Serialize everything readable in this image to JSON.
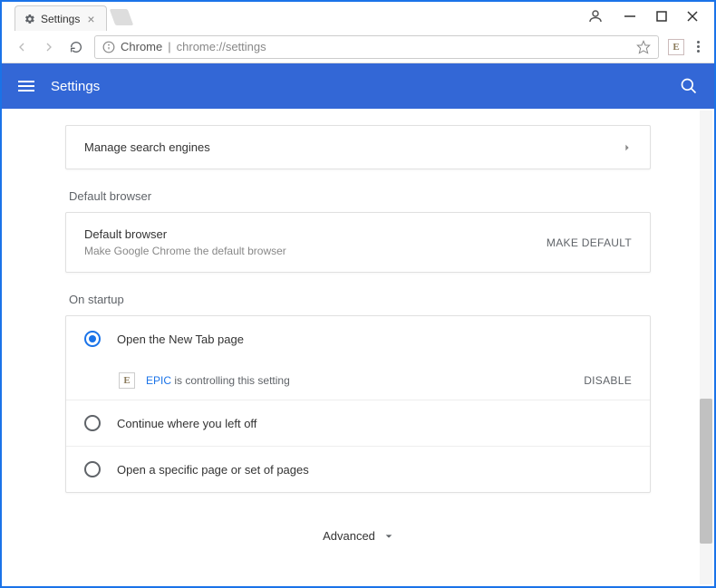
{
  "window": {
    "tab_title": "Settings",
    "account_icon": "account-icon",
    "minimize": "—",
    "maximize": "☐",
    "close": "✕"
  },
  "toolbar": {
    "chrome_label": "Chrome",
    "url": "chrome://settings",
    "ext_badge": "E"
  },
  "header": {
    "title": "Settings"
  },
  "manage_search": {
    "label": "Manage search engines"
  },
  "default_browser": {
    "section": "Default browser",
    "title": "Default browser",
    "subtitle": "Make Google Chrome the default browser",
    "action": "MAKE DEFAULT"
  },
  "startup": {
    "section": "On startup",
    "option1": "Open the New Tab page",
    "ext_badge": "E",
    "ext_name": "EPIC",
    "ext_msg": " is controlling this setting",
    "disable": "DISABLE",
    "option2": "Continue where you left off",
    "option3": "Open a specific page or set of pages"
  },
  "advanced": "Advanced"
}
